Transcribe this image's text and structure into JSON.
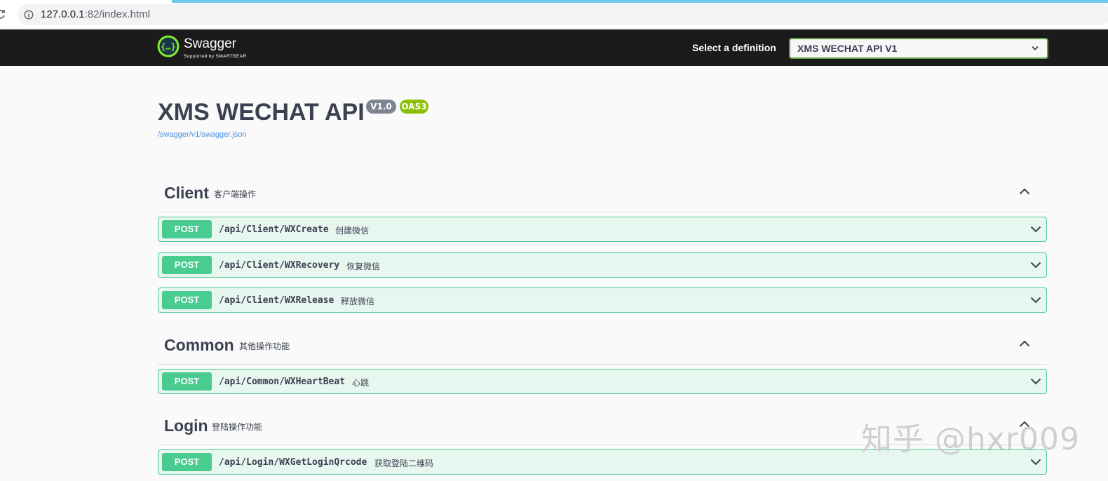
{
  "browser": {
    "url_host": "127.0.0.1",
    "url_rest": ":82/index.html"
  },
  "topbar": {
    "logo_name": "Swagger",
    "logo_sub": "Supported by SMARTBEAR",
    "definition_label": "Select a definition",
    "definition_value": "XMS WECHAT API V1",
    "background": "#1b1b1b",
    "select_border": "#62a03f"
  },
  "info": {
    "title": "XMS WECHAT API",
    "version": "V1.0",
    "oas": "OAS3",
    "spec_link": "/swagger/v1/swagger.json",
    "link_color": "#4990e2"
  },
  "tags": [
    {
      "name": "Client",
      "description": "客户端操作",
      "operations": [
        {
          "method": "POST",
          "path": "/api/Client/WXCreate",
          "summary": "创建微信"
        },
        {
          "method": "POST",
          "path": "/api/Client/WXRecovery",
          "summary": "恢复微信"
        },
        {
          "method": "POST",
          "path": "/api/Client/WXRelease",
          "summary": "释放微信"
        }
      ]
    },
    {
      "name": "Common",
      "description": "其他操作功能",
      "operations": [
        {
          "method": "POST",
          "path": "/api/Common/WXHeartBeat",
          "summary": "心跳"
        }
      ]
    },
    {
      "name": "Login",
      "description": "登陆操作功能",
      "operations": [
        {
          "method": "POST",
          "path": "/api/Login/WXGetLoginQrcode",
          "summary": "获取登陆二维码"
        }
      ]
    }
  ],
  "colors": {
    "post": "#49cc90",
    "post_bg": "#e8f6f0",
    "version_badge": "#7d8492",
    "oas_badge": "#89bf04"
  },
  "icons": {
    "reload": "reload-icon",
    "info": "info-icon",
    "logo": "swagger-logo-icon",
    "collapse": "chevron-up-icon",
    "expand": "chevron-down-icon"
  },
  "watermark": "知乎 @hxr009"
}
